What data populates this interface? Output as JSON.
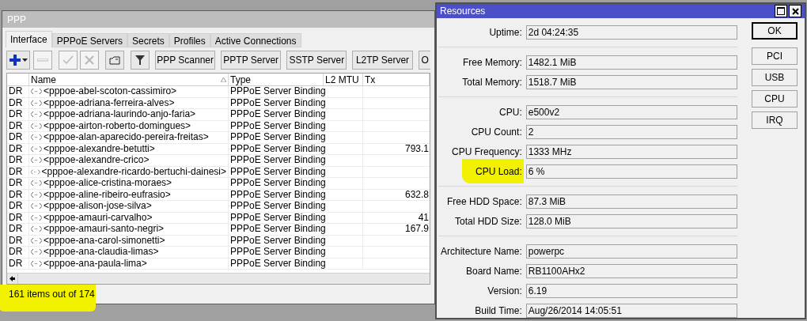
{
  "ppp_window": {
    "title": "PPP",
    "tabs": [
      {
        "label": "Interface",
        "selected": true
      },
      {
        "label": "PPPoE Servers",
        "selected": false
      },
      {
        "label": "Secrets",
        "selected": false
      },
      {
        "label": "Profiles",
        "selected": false
      },
      {
        "label": "Active Connections",
        "selected": false
      }
    ],
    "icon_buttons": [
      {
        "kind": "add",
        "disabled": false
      },
      {
        "kind": "remove",
        "disabled": true
      },
      {
        "kind": "enable",
        "disabled": true
      },
      {
        "kind": "disable",
        "disabled": true
      },
      {
        "kind": "comment",
        "disabled": false
      },
      {
        "kind": "filter",
        "disabled": false
      }
    ],
    "text_buttons": [
      "PPP Scanner",
      "PPTP Server",
      "SSTP Server",
      "L2TP Server",
      "O"
    ],
    "columns": [
      "Name",
      "Type",
      "L2 MTU",
      "Tx"
    ],
    "rows": [
      {
        "flags": "DR",
        "name": "<pppoe-abel-scoton-cassimiro>",
        "type": "PPPoE Server Binding"
      },
      {
        "flags": "DR",
        "name": "<pppoe-adriana-ferreira-alves>",
        "type": "PPPoE Server Binding"
      },
      {
        "flags": "DR",
        "name": "<pppoe-adriana-laurindo-anjo-faria>",
        "type": "PPPoE Server Binding"
      },
      {
        "flags": "DR",
        "name": "<pppoe-airton-roberto-domingues>",
        "type": "PPPoE Server Binding"
      },
      {
        "flags": "DR",
        "name": "<pppoe-alan-aparecido-pereira-freitas>",
        "type": "PPPoE Server Binding"
      },
      {
        "flags": "DR",
        "name": "<pppoe-alexandre-betutti>",
        "type": "PPPoE Server Binding",
        "tx": "793.1"
      },
      {
        "flags": "DR",
        "name": "<pppoe-alexandre-crico>",
        "type": "PPPoE Server Binding"
      },
      {
        "flags": "DR",
        "name": "<pppoe-alexandre-ricardo-bertuchi-dainesi>",
        "type": "PPPoE Server Binding"
      },
      {
        "flags": "DR",
        "name": "<pppoe-alice-cristina-moraes>",
        "type": "PPPoE Server Binding"
      },
      {
        "flags": "DR",
        "name": "<pppoe-aline-ribeiro-eufrasio>",
        "type": "PPPoE Server Binding",
        "tx": "632.8"
      },
      {
        "flags": "DR",
        "name": "<pppoe-alison-jose-silva>",
        "type": "PPPoE Server Binding"
      },
      {
        "flags": "DR",
        "name": "<pppoe-amauri-carvalho>",
        "type": "PPPoE Server Binding",
        "tx": "41"
      },
      {
        "flags": "DR",
        "name": "<pppoe-amauri-santo-negri>",
        "type": "PPPoE Server Binding",
        "tx": "167.9"
      },
      {
        "flags": "DR",
        "name": "<pppoe-ana-carol-simonetti>",
        "type": "PPPoE Server Binding"
      },
      {
        "flags": "DR",
        "name": "<pppoe-ana-claudia-limas>",
        "type": "PPPoE Server Binding"
      },
      {
        "flags": "DR",
        "name": "<pppoe-ana-paula-lima>",
        "type": "PPPoE Server Binding"
      }
    ],
    "status": {
      "text": "161 items out of 174",
      "highlighted": true
    }
  },
  "resources": {
    "title": "Resources",
    "groups": [
      [
        {
          "label": "Uptime:",
          "value": "2d 04:24:35",
          "highlighted": false
        }
      ],
      [
        {
          "label": "Free Memory:",
          "value": "1482.1 MiB",
          "highlighted": false
        },
        {
          "label": "Total Memory:",
          "value": "1518.7 MiB",
          "highlighted": false
        }
      ],
      [
        {
          "label": "CPU:",
          "value": "e500v2",
          "highlighted": false
        },
        {
          "label": "CPU Count:",
          "value": "2",
          "highlighted": false
        },
        {
          "label": "CPU Frequency:",
          "value": "1333 MHz",
          "highlighted": false
        },
        {
          "label": "CPU Load:",
          "value": "6 %",
          "highlighted": true
        }
      ],
      [
        {
          "label": "Free HDD Space:",
          "value": "87.3 MiB",
          "highlighted": false
        },
        {
          "label": "Total HDD Size:",
          "value": "128.0 MiB",
          "highlighted": false
        }
      ],
      [
        {
          "label": "Architecture Name:",
          "value": "powerpc",
          "highlighted": false
        },
        {
          "label": "Board Name:",
          "value": "RB1100AHx2",
          "highlighted": false
        },
        {
          "label": "Version:",
          "value": "6.19",
          "highlighted": false
        },
        {
          "label": "Build Time:",
          "value": "Aug/26/2014 14:05:51",
          "highlighted": false
        }
      ]
    ],
    "buttons": [
      {
        "label": "OK",
        "default": true
      },
      {
        "label": "PCI",
        "default": false
      },
      {
        "label": "USB",
        "default": false
      },
      {
        "label": "CPU",
        "default": false
      },
      {
        "label": "IRQ",
        "default": false
      }
    ]
  }
}
